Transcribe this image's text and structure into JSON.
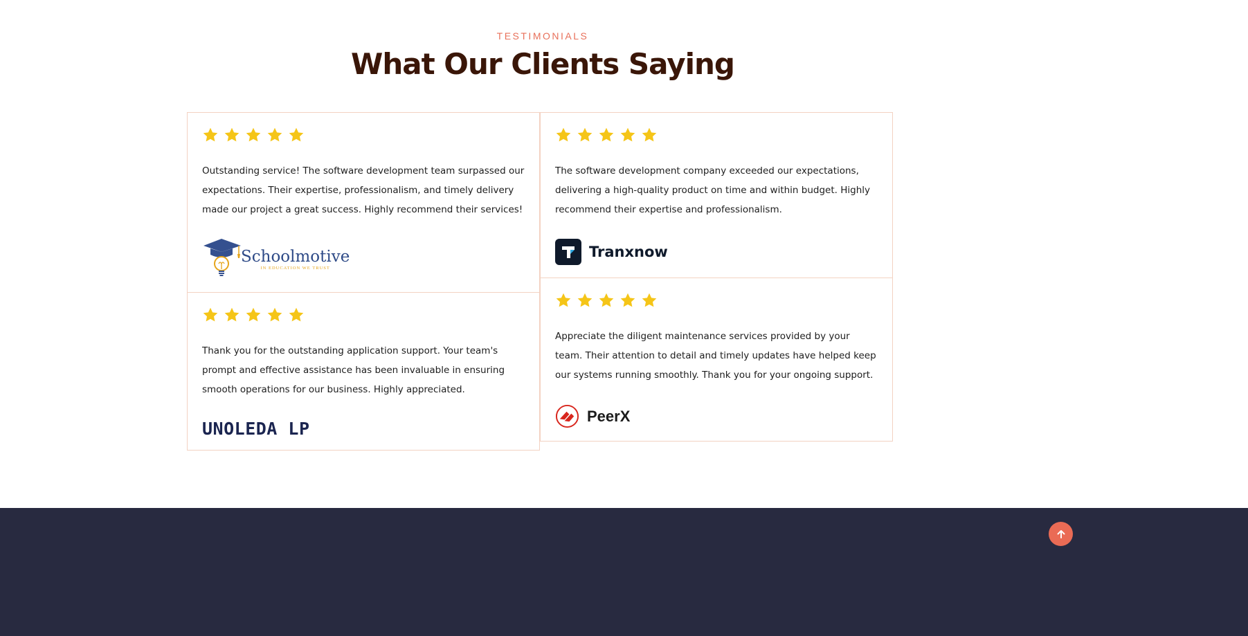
{
  "section": {
    "label": "TESTIMONIALS",
    "title": "What Our Clients Saying"
  },
  "colors": {
    "accent": "#e8705a",
    "title": "#3a1608",
    "star": "#f5c518",
    "card_border": "#f3d2c2",
    "footer": "#282a40",
    "scroll_button": "#ea6b55"
  },
  "testimonials": [
    {
      "rating": 5,
      "quote": "Outstanding service! The software development team surpassed our expectations. Their expertise, professionalism, and timely delivery made our project a great success. Highly recommend their services!",
      "company": "Schoolmotive",
      "company_tagline": "IN EDUCATION WE TRUST",
      "logo_icon": "graduation-cap-bulb-icon"
    },
    {
      "rating": 5,
      "quote": "Thank you for the outstanding application support. Your team's prompt and effective assistance has been invaluable in ensuring smooth operations for our business. Highly appreciated.",
      "company": "UNOLEDA LP",
      "logo_icon": "wordmark"
    },
    {
      "rating": 5,
      "quote": "The software development company exceeded our expectations, delivering a high-quality product on time and within budget. Highly recommend their expertise and professionalism.",
      "company": "Tranxnow",
      "logo_icon": "t-badge-icon"
    },
    {
      "rating": 5,
      "quote": "Appreciate the diligent maintenance services provided by your team. Their attention to detail and timely updates have helped keep our systems running smoothly. Thank you for your ongoing support.",
      "company": "PeerX",
      "logo_icon": "peerx-circle-icon"
    }
  ],
  "scroll_top": {
    "icon": "arrow-up-icon"
  }
}
